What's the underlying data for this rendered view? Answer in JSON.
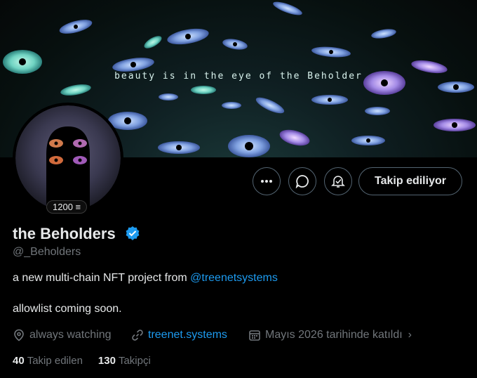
{
  "banner": {
    "tagline": "beauty is in the eye of the Beholder"
  },
  "avatar": {
    "badge": "1200"
  },
  "actions": {
    "more": "more",
    "message": "message",
    "notify": "notify",
    "follow_label": "Takip ediliyor"
  },
  "profile": {
    "name": "the Beholders",
    "handle": "@_Beholders",
    "bio_line1_text": "a new multi-chain NFT project from ",
    "bio_line1_mention": "@treenetsystems",
    "bio_line2": "allowlist coming soon.",
    "location": "always watching",
    "website": "treenet.systems",
    "joined": "Mayıs 2026 tarihinde katıldı"
  },
  "stats": {
    "following_count": "40",
    "following_label": "Takip edilen",
    "followers_count": "130",
    "followers_label": "Takipçi"
  },
  "colors": {
    "accent": "#1d9bf0",
    "muted": "#71767b",
    "text": "#e7e9ea"
  }
}
